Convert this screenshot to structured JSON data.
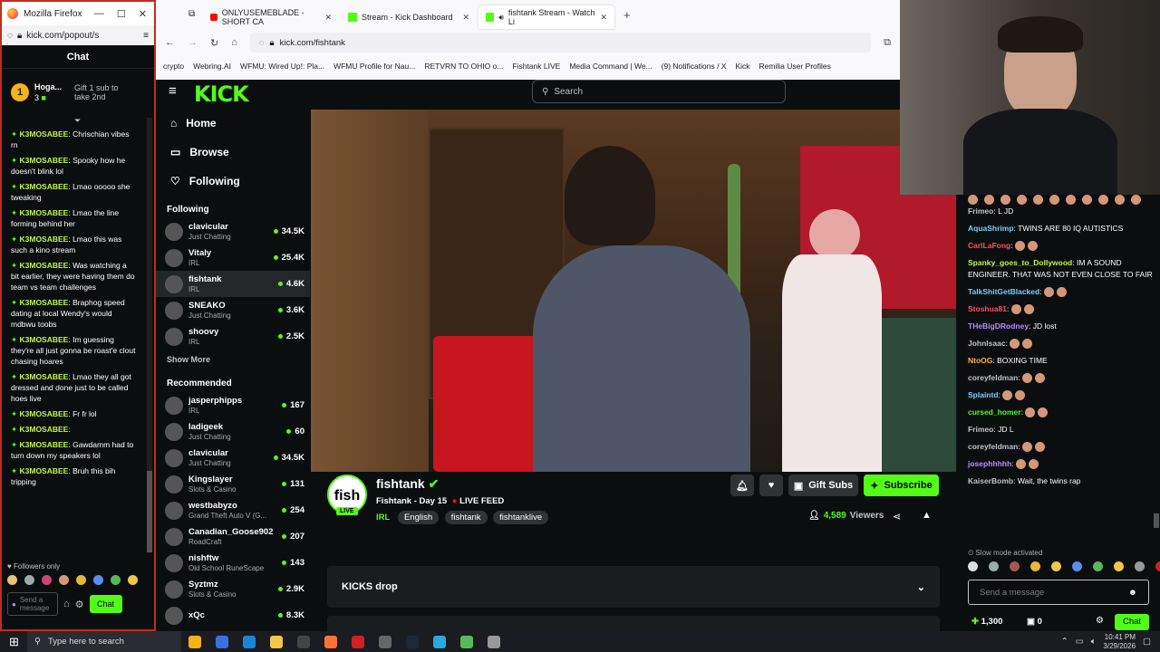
{
  "popout": {
    "window_title": "Mozilla Firefox",
    "url": "kick.com/popout/s",
    "chat_title": "Chat",
    "pinned_user": "Hoga...",
    "pinned_rank": "1",
    "pinned_count": "3",
    "gift_text": "Gift 1 sub to take 2nd",
    "messages": [
      {
        "user": "K3MOSABEE",
        "text": "Chrischian vibes rn"
      },
      {
        "user": "K3MOSABEE",
        "text": "Spooky how he doesn't blink lol"
      },
      {
        "user": "K3MOSABEE",
        "text": "Lmao ooooo she tweaking"
      },
      {
        "user": "K3MOSABEE",
        "text": "Lmao the line forming behind her"
      },
      {
        "user": "K3MOSABEE",
        "text": "Lmao this was such a kino stream"
      },
      {
        "user": "K3MOSABEE",
        "text": "Was watching a bit earlier, they were having them do team vs team challenges"
      },
      {
        "user": "K3MOSABEE",
        "text": "Braphog speed dating at local Wendy's would mdbwu toobs"
      },
      {
        "user": "K3MOSABEE",
        "text": "Im guessing they're all just gonna be roast'e clout chasing hoares"
      },
      {
        "user": "K3MOSABEE",
        "text": "Lmao they all got dressed and done just to be called hoes live"
      },
      {
        "user": "K3MOSABEE",
        "text": "Fr fr lol"
      },
      {
        "user": "K3MOSABEE",
        "text": ""
      },
      {
        "user": "K3MOSABEE",
        "text": "Gawdamm had to turn down my speakers lol"
      },
      {
        "user": "K3MOSABEE",
        "text": "Bruh this bih tripping"
      }
    ],
    "followers_only": "Followers only",
    "send_placeholder": "Send a message",
    "chat_button": "Chat"
  },
  "browser": {
    "tabs": [
      {
        "label": "ONLYUSEMEBLADE - SHORT CA",
        "active": false
      },
      {
        "label": "Stream - Kick Dashboard",
        "active": false
      },
      {
        "label": "fishtank Stream - Watch Li",
        "active": true
      }
    ],
    "new_tab": "+",
    "url": "kick.com/fishtank",
    "bookmarks": [
      "crypto",
      "Webring.AI",
      "WFMU: Wired Up!: Pla...",
      "WFMU Profile for Nau...",
      "RETVRN TO OHIO o...",
      "Fishtank LIVE",
      "Media Command | We...",
      "(9) Notifications / X",
      "Kick",
      "Remilia User Profiles"
    ]
  },
  "kick": {
    "logo": "KICK",
    "search_placeholder": "Search",
    "nav": [
      {
        "label": "Home",
        "icon": "home-icon"
      },
      {
        "label": "Browse",
        "icon": "browse-icon"
      },
      {
        "label": "Following",
        "icon": "heart-icon"
      }
    ],
    "following_title": "Following",
    "following": [
      {
        "name": "clavicular",
        "category": "Just Chatting",
        "viewers": "34.5K"
      },
      {
        "name": "Vitaly",
        "category": "IRL",
        "viewers": "25.4K"
      },
      {
        "name": "fishtank",
        "category": "IRL",
        "viewers": "4.6K"
      },
      {
        "name": "SNEAKO",
        "category": "Just Chatting",
        "viewers": "3.6K"
      },
      {
        "name": "shoovy",
        "category": "IRL",
        "viewers": "2.5K"
      }
    ],
    "show_more": "Show More",
    "recommended_title": "Recommended",
    "recommended": [
      {
        "name": "jasperphipps",
        "category": "IRL",
        "viewers": "167"
      },
      {
        "name": "ladigeek",
        "category": "Just Chatting",
        "viewers": "60"
      },
      {
        "name": "clavicular",
        "category": "Just Chatting",
        "viewers": "34.5K"
      },
      {
        "name": "Kingslayer",
        "category": "Slots & Casino",
        "viewers": "131"
      },
      {
        "name": "westbabyzo",
        "category": "Grand Theft Auto V (G...",
        "viewers": "254"
      },
      {
        "name": "Canadian_Goose902",
        "category": "RoadCraft",
        "viewers": "207"
      },
      {
        "name": "nishftw",
        "category": "Old School RuneScape",
        "viewers": "143"
      },
      {
        "name": "Syztmz",
        "category": "Slots & Casino",
        "viewers": "2.9K"
      },
      {
        "name": "xQc",
        "category": "",
        "viewers": "8.3K"
      }
    ],
    "channel": {
      "name": "fishtank",
      "avatar_text": "fish",
      "live_badge": "LIVE",
      "stream_title": "Fishtank - Day 15",
      "live_feed": "LIVE FEED",
      "tags": [
        "IRL",
        "English",
        "fishtank",
        "fishtanklive"
      ],
      "viewers": "4,589",
      "viewers_label": "Viewers",
      "gift_subs": "Gift Subs",
      "subscribe": "Subscribe",
      "kicks_drop": "KICKS drop"
    }
  },
  "right_chat": {
    "messages": [
      {
        "user": "Frimeo",
        "color": "#c0c3c6",
        "text": "L JD"
      },
      {
        "user": "AquaShrimp",
        "color": "#75d1ff",
        "text": "TWINS ARE 80 IQ AUTISTICS"
      },
      {
        "user": "CarlLaFong",
        "color": "#ff4d6a",
        "text": ""
      },
      {
        "user": "Spanky_goes_to_Dollywood",
        "color": "#c1f54a",
        "text": "IM A SOUND ENGINEER. THAT WAS NOT EVEN CLOSE TO FAIR"
      },
      {
        "user": "TalkShitGetBlacked",
        "color": "#75d1ff",
        "text": ""
      },
      {
        "user": "Stoshua81",
        "color": "#ff4d6a",
        "text": ""
      },
      {
        "user": "THeBigDRodney",
        "color": "#b98cff",
        "text": "JD lost"
      },
      {
        "user": "Johnlsaac",
        "color": "#c0c3c6",
        "text": ""
      },
      {
        "user": "NtoOG",
        "color": "#ffb347",
        "text": "BOXING TIME"
      },
      {
        "user": "coreyfeldman",
        "color": "#c0c3c6",
        "text": ""
      },
      {
        "user": "Splaintd",
        "color": "#75d1ff",
        "text": ""
      },
      {
        "user": "cursed_homer",
        "color": "#53fc18",
        "text": ""
      },
      {
        "user": "Frimeo",
        "color": "#c0c3c6",
        "text": "JD L"
      },
      {
        "user": "coreyfeldman",
        "color": "#c0c3c6",
        "text": ""
      },
      {
        "user": "josephhhhh",
        "color": "#b98cff",
        "text": ""
      },
      {
        "user": "KaiserBomb",
        "color": "#c0c3c6",
        "text": "Wait, the twins rap"
      }
    ],
    "slow_mode": "Slow mode activated",
    "placeholder": "Send a message",
    "points": "1,300",
    "gifts": "0",
    "chat_button": "Chat"
  },
  "taskbar": {
    "search_placeholder": "Type here to search",
    "time": "10:41 PM",
    "date": "3/29/2026"
  }
}
